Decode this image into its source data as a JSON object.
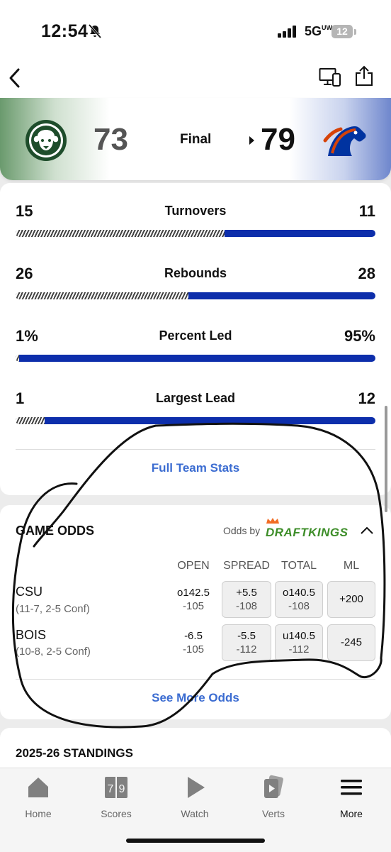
{
  "status_bar": {
    "time": "12:54",
    "network": "5G",
    "network_sub": "UW",
    "battery": "12"
  },
  "scoreboard": {
    "away": {
      "abbr": "CSU",
      "score": "73"
    },
    "status": "Final",
    "home": {
      "abbr": "BOIS",
      "score": "79"
    }
  },
  "stats": [
    {
      "label": "Turnovers",
      "away": "15",
      "home": "11",
      "away_share": 0.58
    },
    {
      "label": "Rebounds",
      "away": "26",
      "home": "28",
      "away_share": 0.48
    },
    {
      "label": "Percent Led",
      "away": "1%",
      "home": "95%",
      "away_share": 0.01
    },
    {
      "label": "Largest Lead",
      "away": "1",
      "home": "12",
      "away_share": 0.08
    }
  ],
  "full_stats_link": "Full Team Stats",
  "odds": {
    "title": "GAME ODDS",
    "provider_prefix": "Odds by",
    "provider": "DRAFTKINGS",
    "columns": [
      "OPEN",
      "SPREAD",
      "TOTAL",
      "ML"
    ],
    "rows": [
      {
        "team": "CSU",
        "record": "(11-7, 2-5 Conf)",
        "open": "o142.5",
        "open_sub": "-105",
        "spread": "+5.5",
        "spread_sub": "-108",
        "total": "o140.5",
        "total_sub": "-108",
        "ml": "+200"
      },
      {
        "team": "BOIS",
        "record": "(10-8, 2-5 Conf)",
        "open": "-6.5",
        "open_sub": "-105",
        "spread": "-5.5",
        "spread_sub": "-112",
        "total": "u140.5",
        "total_sub": "-112",
        "ml": "-245"
      }
    ],
    "see_more": "See More Odds"
  },
  "standings_title": "2025-26 STANDINGS",
  "tabs": [
    {
      "label": "Home",
      "icon": "home-icon"
    },
    {
      "label": "Scores",
      "icon": "scores-icon"
    },
    {
      "label": "Watch",
      "icon": "play-icon"
    },
    {
      "label": "Verts",
      "icon": "verts-icon"
    },
    {
      "label": "More",
      "icon": "menu-icon"
    }
  ],
  "colors": {
    "home_bar": "#0d2eab",
    "link": "#3b6cd1",
    "draftkings": "#3e8e2a"
  }
}
